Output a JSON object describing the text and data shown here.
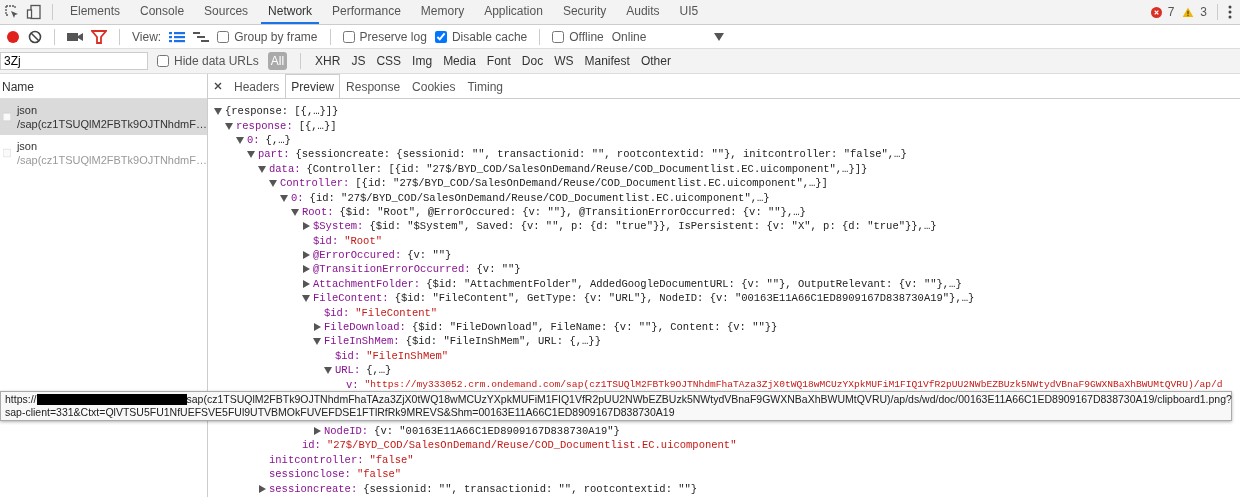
{
  "main_tabs": [
    {
      "label": "Elements",
      "selected": false
    },
    {
      "label": "Console",
      "selected": false
    },
    {
      "label": "Sources",
      "selected": false
    },
    {
      "label": "Network",
      "selected": true
    },
    {
      "label": "Performance",
      "selected": false
    },
    {
      "label": "Memory",
      "selected": false
    },
    {
      "label": "Application",
      "selected": false
    },
    {
      "label": "Security",
      "selected": false
    },
    {
      "label": "Audits",
      "selected": false
    },
    {
      "label": "UI5",
      "selected": false
    }
  ],
  "counters": {
    "errors": "7",
    "warnings": "3"
  },
  "toolbar": {
    "recording": true,
    "view_label": "View:",
    "views": [
      {
        "kind": "list",
        "selected": true
      },
      {
        "kind": "waterfall",
        "selected": false
      }
    ],
    "options": [
      {
        "label": "Group by frame",
        "checked": false
      },
      {
        "label": "Preserve log",
        "checked": false
      },
      {
        "label": "Disable cache",
        "checked": true
      },
      {
        "label": "Offline",
        "checked": false
      }
    ],
    "throttling": "Online"
  },
  "filter_bar": {
    "value": "3Zj",
    "hide_data_urls": {
      "label": "Hide data URLs",
      "checked": false
    },
    "types": [
      {
        "label": "All",
        "selected": true
      },
      {
        "label": "XHR",
        "selected": false
      },
      {
        "label": "JS",
        "selected": false
      },
      {
        "label": "CSS",
        "selected": false
      },
      {
        "label": "Img",
        "selected": false
      },
      {
        "label": "Media",
        "selected": false
      },
      {
        "label": "Font",
        "selected": false
      },
      {
        "label": "Doc",
        "selected": false
      },
      {
        "label": "WS",
        "selected": false
      },
      {
        "label": "Manifest",
        "selected": false
      },
      {
        "label": "Other",
        "selected": false
      }
    ]
  },
  "requests": {
    "column": "Name",
    "rows": [
      {
        "name": "json",
        "path": "/sap(cz1TSUQlM2FBTk9OJTNhdmF…",
        "selected": true
      },
      {
        "name": "json",
        "path": "/sap(cz1TSUQlM2FBTk9OJTNhdmF…",
        "selected": false
      }
    ]
  },
  "detail_tabs": [
    {
      "label": "Headers",
      "selected": false
    },
    {
      "label": "Preview",
      "selected": true
    },
    {
      "label": "Response",
      "selected": false
    },
    {
      "label": "Cookies",
      "selected": false
    },
    {
      "label": "Timing",
      "selected": false
    }
  ],
  "preview": {
    "value": "{response: [{,…}]}",
    "kind": "summary",
    "expanded": true,
    "children": [
      {
        "key": "response:",
        "value": "[{,…}]",
        "kind": "summary",
        "expanded": true,
        "children": [
          {
            "key": "0:",
            "value": "{,…}",
            "kind": "summary",
            "expanded": true,
            "children": [
              {
                "key": "part:",
                "value": "{sessioncreate: {sessionid: \"\", transactionid: \"\", rootcontextid: \"\"}, initcontroller: \"false\",…}",
                "kind": "summary",
                "expanded": true,
                "children": [
                  {
                    "key": "data:",
                    "value": "{Controller: [{id: \"27$/BYD_COD/SalesOnDemand/Reuse/COD_Documentlist.EC.uicomponent\",…}]}",
                    "kind": "summary",
                    "expanded": true,
                    "children": [
                      {
                        "key": "Controller:",
                        "value": "[{id: \"27$/BYD_COD/SalesOnDemand/Reuse/COD_Documentlist.EC.uicomponent\",…}]",
                        "kind": "summary",
                        "expanded": true,
                        "children": [
                          {
                            "key": "0:",
                            "value": "{id: \"27$/BYD_COD/SalesOnDemand/Reuse/COD_Documentlist.EC.uicomponent\",…}",
                            "kind": "summary",
                            "expanded": true,
                            "children": [
                              {
                                "key": "Root:",
                                "value": "{$id: \"Root\", @ErrorOccured: {v: \"\"}, @TransitionErrorOccurred: {v: \"\"},…}",
                                "kind": "summary",
                                "expanded": true,
                                "children": [
                                  {
                                    "key": "$System:",
                                    "value": "{$id: \"$System\", Saved: {v: \"\", p: {d: \"true\"}}, IsPersistent: {v: \"X\", p: {d: \"true\"}},…}",
                                    "kind": "summary",
                                    "expanded": false
                                  },
                                  {
                                    "key": "$id:",
                                    "value": "\"Root\"",
                                    "kind": "string"
                                  },
                                  {
                                    "key": "@ErrorOccured:",
                                    "value": "{v: \"\"}",
                                    "kind": "summary",
                                    "expanded": false
                                  },
                                  {
                                    "key": "@TransitionErrorOccurred:",
                                    "value": "{v: \"\"}",
                                    "kind": "summary",
                                    "expanded": false
                                  },
                                  {
                                    "key": "AttachmentFolder:",
                                    "value": "{$id: \"AttachmentFolder\", AddedGoogleDocumentURL: {v: \"\"}, OutputRelevant: {v: \"\"},…}",
                                    "kind": "summary",
                                    "expanded": false
                                  },
                                  {
                                    "key": "FileContent:",
                                    "value": "{$id: \"FileContent\", GetType: {v: \"URL\"}, NodeID: {v: \"00163E11A66C1ED8909167D838730A19\"},…}",
                                    "kind": "summary",
                                    "expanded": true,
                                    "children": [
                                      {
                                        "key": "$id:",
                                        "value": "\"FileContent\"",
                                        "kind": "string"
                                      },
                                      {
                                        "key": "FileDownload:",
                                        "value": "{$id: \"FileDownload\", FileName: {v: \"\"}, Content: {v: \"\"}}",
                                        "kind": "summary",
                                        "expanded": false
                                      },
                                      {
                                        "key": "FileInShMem:",
                                        "value": "{$id: \"FileInShMem\", URL: {,…}}",
                                        "kind": "summary",
                                        "expanded": true,
                                        "children": [
                                          {
                                            "key": "$id:",
                                            "value": "\"FileInShMem\"",
                                            "kind": "string"
                                          },
                                          {
                                            "key": "URL:",
                                            "value": "{,…}",
                                            "kind": "summary",
                                            "expanded": true,
                                            "children": [
                                              {
                                                "key": "v:",
                                                "value": "\"https://my333052.crm.ondemand.com/sap(cz1TSUQlM2FBTk9OJTNhdmFhaTAza3ZjX0tWQ18wMCUzYXpkMUFiM1FIQ1VfR2pUU2NWbEZBUzk5NWtydVBnaF9GWXNBaXhBWUMtQVRU)/ap/d",
                                                "kind": "string"
                                              }
                                            ]
                                          }
                                        ]
                                      },
                                      {
                                        "key": "NodeID:",
                                        "value": "{v: \"00163E11A66C1ED8909167D838730A19\"}",
                                        "kind": "summary",
                                        "expanded": false
                                      }
                                    ]
                                  }
                                ]
                              },
                              {
                                "key": "id:",
                                "value": "\"27$/BYD_COD/SalesOnDemand/Reuse/COD_Documentlist.EC.uicomponent\"",
                                "kind": "string"
                              }
                            ]
                          }
                        ]
                      }
                    ]
                  },
                  {
                    "key": "initcontroller:",
                    "value": "\"false\"",
                    "kind": "string"
                  },
                  {
                    "key": "sessionclose:",
                    "value": "\"false\"",
                    "kind": "string"
                  },
                  {
                    "key": "sessioncreate:",
                    "value": "{sessionid: \"\", transactionid: \"\", rootcontextid: \"\"}",
                    "kind": "summary",
                    "expanded": false
                  }
                ]
              }
            ]
          }
        ]
      }
    ]
  },
  "tooltip": {
    "prefix": "https://",
    "redacted": true,
    "line_1": "sap(cz1TSUQlM2FBTk9OJTNhdmFhaTAza3ZjX0tWQ18wMCUzYXpkMUFiM1FIQ1VfR2pUU2NWbEZBUzk5NWtydVBnaF9GWXNBaXhBWUMtQVRU)/ap/ds/wd/doc/00163E11A66C1ED8909167D838730A19/clipboard1.png?",
    "line_2": "sap-client=331&Ctxt=QlVTSU5FU1NfUEFSVE5FUl9UTVBMOkFUVEFDSE1FTlRfRk9MREVS&Shm=00163E11A66C1ED8909167D838730A19"
  }
}
